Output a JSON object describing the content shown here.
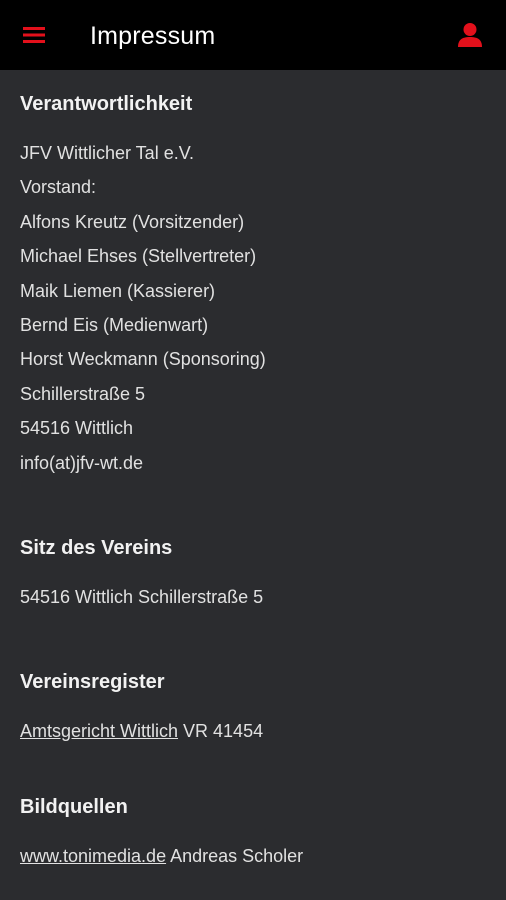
{
  "header": {
    "title": "Impressum",
    "menu_icon": "hamburger-menu-icon",
    "user_icon": "person-icon",
    "accent_color": "#e3101b",
    "background_color": "#000000"
  },
  "sections": {
    "verantwortlichkeit": {
      "heading": "Verantwortlichkeit",
      "lines": [
        "JFV Wittlicher Tal e.V.",
        "Vorstand:",
        "Alfons Kreutz (Vorsitzender)",
        "Michael Ehses (Stellvertreter)",
        "Maik Liemen (Kassierer)",
        "Bernd Eis (Medienwart)",
        "Horst Weckmann (Sponsoring)",
        "Schillerstraße 5",
        "54516 Wittlich",
        "info(at)jfv-wt.de"
      ]
    },
    "sitz": {
      "heading": "Sitz des Vereins",
      "text": "54516 Wittlich Schillerstraße 5"
    },
    "register": {
      "heading": "Vereinsregister",
      "link_text": "Amtsgericht Wittlich",
      "suffix": " VR 41454"
    },
    "bildquellen": {
      "heading": "Bildquellen",
      "link_text": "www.tonimedia.de",
      "suffix": " Andreas Scholer"
    }
  }
}
